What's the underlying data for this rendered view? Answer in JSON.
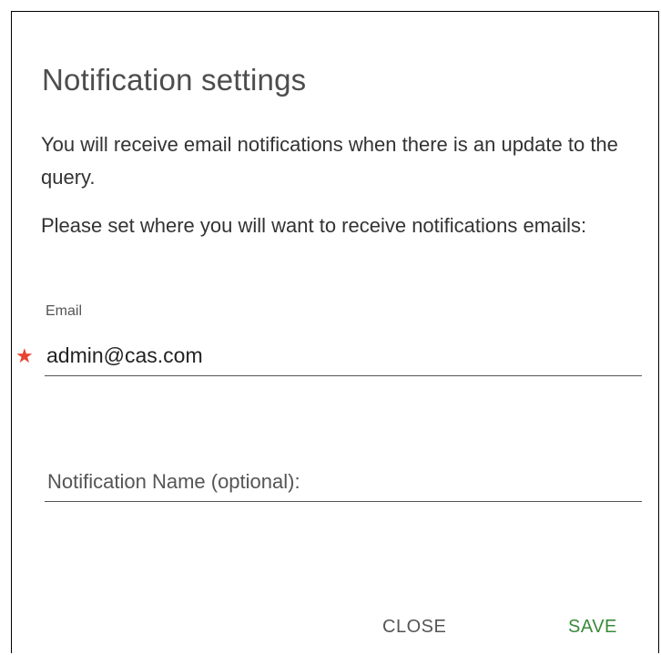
{
  "dialog": {
    "title": "Notification settings",
    "description_1": "You will receive email notifications when there is an update to the query.",
    "description_2": "Please set where you will want to receive notifications emails:",
    "email_field": {
      "label": "Email",
      "value": "admin@cas.com",
      "required_marker": "★"
    },
    "name_field": {
      "placeholder": "Notification Name (optional):",
      "value": ""
    },
    "buttons": {
      "close_label": "CLOSE",
      "save_label": "SAVE"
    }
  },
  "colors": {
    "required": "#e8442f",
    "save_accent": "#3a8a3a",
    "underline": "#555555"
  }
}
